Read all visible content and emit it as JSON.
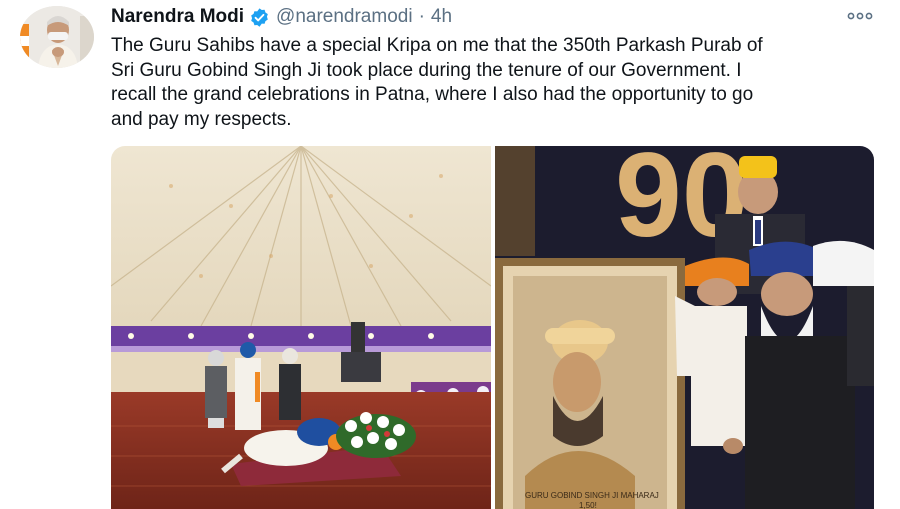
{
  "tweet": {
    "author_name": "Narendra Modi",
    "handle": "@narendramodi",
    "separator": "·",
    "time": "4h",
    "text": "The Guru Sahibs have a special Kripa on me that the 350th Parkash Purab of\nSri Guru Gobind Singh Ji took place during the tenure of our Government. I\nrecall the grand celebrations in Patna, where I also had the opportunity to go\nand pay my respects."
  },
  "icons": {
    "verified": "verified-badge-icon",
    "more": "more-options-icon"
  },
  "colors": {
    "verified_blue": "#1da1f2",
    "secondary_text": "#5b7083",
    "primary_text": "#0f1419"
  },
  "photos": {
    "right_caption": "GURU GOBIND SINGH JI MAHARAJ",
    "right_caption_line2": "1,50!",
    "backdrop_numeral": "90"
  }
}
